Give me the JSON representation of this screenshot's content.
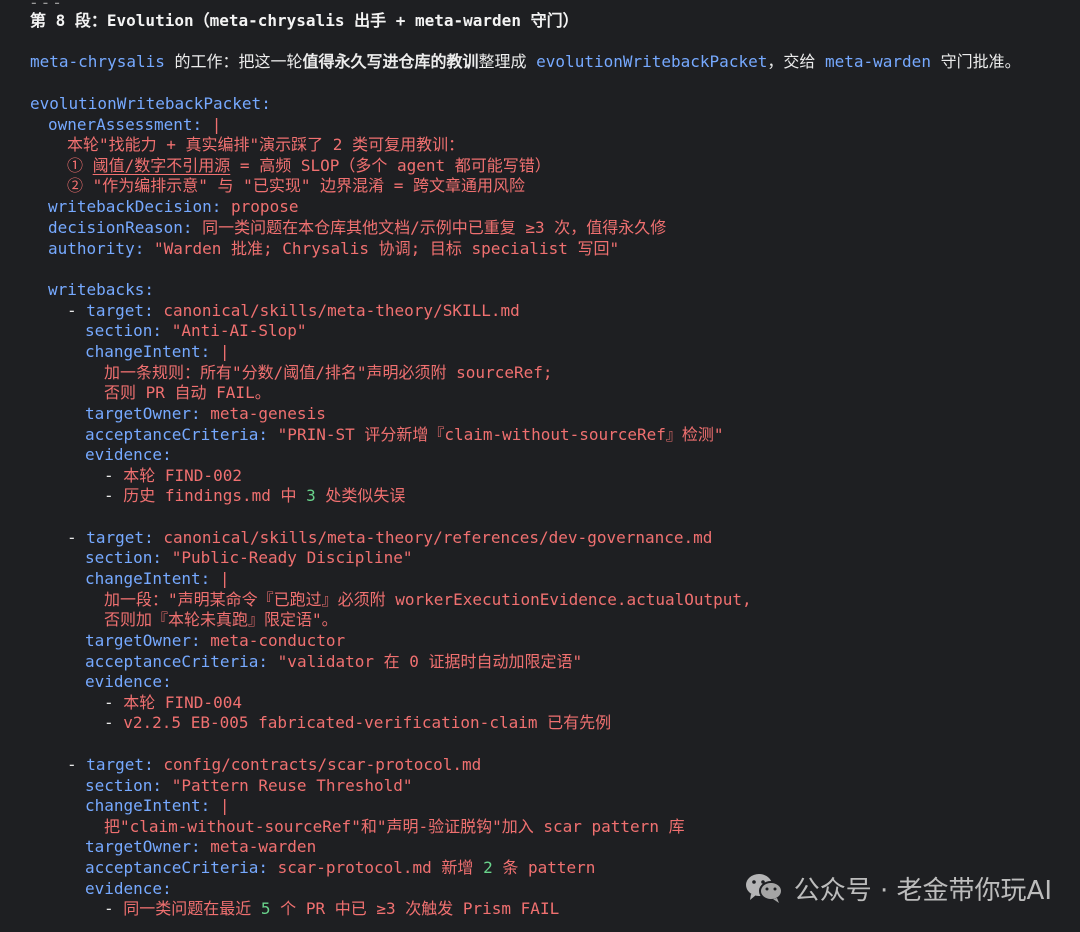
{
  "header": {
    "top_rule": "---",
    "title": "第 8 段：Evolution（meta-chrysalis 出手 + meta-warden 守门）"
  },
  "intro": {
    "agent": "meta-chrysalis",
    "t1": " 的工作：把这一轮",
    "bold": "值得永久写进仓库的教训",
    "t2": "整理成 ",
    "packet": "evolutionWritebackPacket",
    "t3": "，交给 ",
    "warden": "meta-warden",
    "t4": " 守门批准。"
  },
  "code": {
    "root_key": "evolutionWritebackPacket:",
    "owner_assessment_key": "ownerAssessment:",
    "owner_assessment_pipe": "|",
    "owner_line1": "本轮\"找能力 + 真实编排\"演示踩了 2 类可复用教训：",
    "owner_line2_num": "①",
    "owner_line2_u": "阈值/数字不引用源",
    "owner_line2_rest": " = 高频 SLOP（多个 agent 都可能写错）",
    "owner_line3_num": "②",
    "owner_line3_rest": " \"作为编排示意\" 与 \"已实现\" 边界混淆 = 跨文章通用风险",
    "decision_key": "writebackDecision:",
    "decision_val": "propose",
    "reason_key": "decisionReason:",
    "reason_val": "同一类问题在本仓库其他文档/示例中已重复 ≥3 次，值得永久修",
    "authority_key": "authority:",
    "authority_val": "\"Warden 批准; Chrysalis 协调; 目标 specialist 写回\"",
    "writebacks_key": "writebacks:",
    "items": [
      {
        "target_key": "target:",
        "target_val": "canonical/skills/meta-theory/SKILL.md",
        "section_key": "section:",
        "section_val": "\"Anti-AI-Slop\"",
        "intent_key": "changeIntent:",
        "intent_pipe": "|",
        "intent_lines": [
          "加一条规则：所有\"分数/阈值/排名\"声明必须附 sourceRef;",
          "否则 PR 自动 FAIL。"
        ],
        "owner_key": "targetOwner:",
        "owner_val": "meta-genesis",
        "criteria_key": "acceptanceCriteria:",
        "criteria_val": "\"PRIN-ST 评分新增『claim-without-sourceRef』检测\"",
        "evidence_key": "evidence:",
        "ev1": "本轮 FIND-002",
        "ev2_a": "历史 findings.md 中 ",
        "ev2_num": "3",
        "ev2_b": " 处类似失误"
      },
      {
        "target_key": "target:",
        "target_val": "canonical/skills/meta-theory/references/dev-governance.md",
        "section_key": "section:",
        "section_val": "\"Public-Ready Discipline\"",
        "intent_key": "changeIntent:",
        "intent_pipe": "|",
        "intent_lines": [
          "加一段：\"声明某命令『已跑过』必须附 workerExecutionEvidence.actualOutput,",
          "否则加『本轮未真跑』限定语\"。"
        ],
        "owner_key": "targetOwner:",
        "owner_val": "meta-conductor",
        "criteria_key": "acceptanceCriteria:",
        "criteria_val": "\"validator 在 0 证据时自动加限定语\"",
        "evidence_key": "evidence:",
        "ev1": "本轮 FIND-004",
        "ev2_a": "v2.2.5 EB-005 fabricated-verification-claim 已有先例",
        "ev2_num": "",
        "ev2_b": ""
      },
      {
        "target_key": "target:",
        "target_val": "config/contracts/scar-protocol.md",
        "section_key": "section:",
        "section_val": "\"Pattern Reuse Threshold\"",
        "intent_key": "changeIntent:",
        "intent_pipe": "|",
        "intent_lines": [
          "把\"claim-without-sourceRef\"和\"声明-验证脱钩\"加入 scar pattern 库"
        ],
        "owner_key": "targetOwner:",
        "owner_val": "meta-warden",
        "criteria_key": "acceptanceCriteria:",
        "criteria_a": "scar-protocol.md 新增 ",
        "criteria_num": "2",
        "criteria_b": " 条 pattern",
        "evidence_key": "evidence:",
        "ev1_a": "同一类问题在最近 ",
        "ev1_num": "5",
        "ev1_b": " 个 PR 中已 ≥3 次触发 Prism FAIL"
      }
    ]
  },
  "watermark": {
    "icon": "wechat-icon",
    "text": "公众号 · 老金带你玩AI"
  },
  "colors": {
    "background": "#1e1f22",
    "key": "#76a9ff",
    "value": "#f07070",
    "number": "#69d38b",
    "text": "#e7e7e7"
  }
}
